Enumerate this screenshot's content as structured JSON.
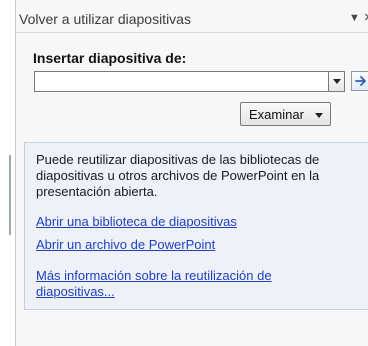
{
  "pane": {
    "title": "Volver a utilizar diapositivas",
    "menu_glyph": "▼",
    "close_glyph": "×"
  },
  "insert": {
    "label": "Insertar diapositiva de:",
    "value": "",
    "placeholder": ""
  },
  "browse": {
    "label": "Examinar"
  },
  "info": {
    "text": "Puede reutilizar diapositivas de las bibliotecas de diapositivas u otros archivos de PowerPoint en la presentación abierta.",
    "links": [
      "Abrir una biblioteca de diapositivas",
      "Abrir un archivo de PowerPoint",
      "Más información sobre la reutilización de diapositivas..."
    ]
  },
  "colors": {
    "link": "#1f3fbf",
    "info_background": "#eef2f8",
    "pane_background": "#f7f7f7"
  },
  "icons": [
    "chevron-down-icon",
    "close-icon",
    "dropdown-arrow-icon",
    "arrow-right-icon"
  ]
}
